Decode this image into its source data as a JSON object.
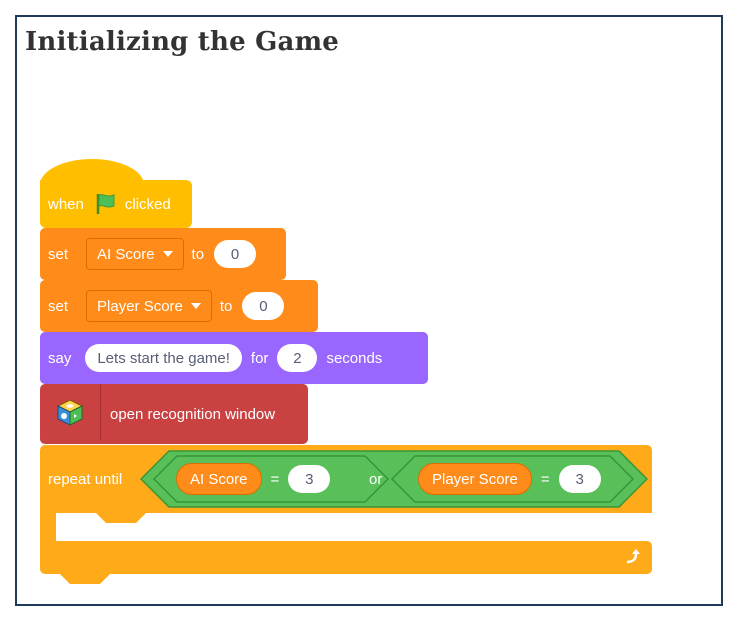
{
  "heading": "Initializing the Game",
  "colors": {
    "events": "#ffbf00",
    "variables": "#ff8c1a",
    "looks": "#9966ff",
    "extension": "#c94141",
    "control": "#ffab19",
    "operators": "#59c059",
    "flag": "#4cbf56"
  },
  "blocks": {
    "when_flag": {
      "when": "when",
      "clicked": "clicked",
      "icon": "green-flag-icon"
    },
    "set_ai": {
      "set": "set",
      "variable": "AI Score",
      "to": "to",
      "value": "0"
    },
    "set_player": {
      "set": "set",
      "variable": "Player Score",
      "to": "to",
      "value": "0"
    },
    "say": {
      "say": "say",
      "message": "Lets start the game!",
      "for": "for",
      "secs": "2",
      "seconds": "seconds"
    },
    "open_window": {
      "label": "open recognition window",
      "icon": "recognition-cube-icon"
    },
    "repeat": {
      "label": "repeat until",
      "left": {
        "variable": "AI Score",
        "op": "=",
        "value": "3"
      },
      "or": "or",
      "right": {
        "variable": "Player Score",
        "op": "=",
        "value": "3"
      },
      "loop_icon": "loop-arrow-icon"
    }
  }
}
